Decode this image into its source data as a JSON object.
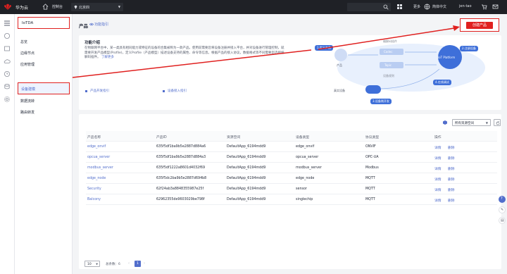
{
  "topbar": {
    "brand": "华为云",
    "console": "控制台",
    "region": "北京四",
    "more": "更多",
    "language": "简体中文",
    "user": "jen-tao"
  },
  "sidenav": {
    "header": "IoTDA",
    "items": [
      "总览",
      "边缘节点",
      "应用管理",
      "设备建模",
      "数据流转",
      "路由转发"
    ],
    "active_index": 3
  },
  "header": {
    "title": "产品",
    "guide": "功能指引",
    "create": "创建产品"
  },
  "intro": {
    "title": "功能介绍",
    "desc": "在物联网平台中，某一类具有相同能力或特征的设备的合集被称为一款产品。使用前需要您将设备注册并接入平台，并对设备进行管理控制，就需要开发产品模型(Profile)，定义Profile（产品模型）描述设备支持的属性、命令等信息。根据产品的接入协议，数据格式等不同需要您选择编解码插件。",
    "more": "了解更多",
    "links": [
      "产品开发指引",
      "设备接入指引"
    ],
    "diagram": {
      "product": "产品",
      "plugin": "编解码插件",
      "codec": "Codec",
      "topic": "Topic",
      "rules": "设备规则",
      "platform": "IoT Platform",
      "device": "真实设备",
      "steps": [
        "1.定义产品",
        "2.注册设备",
        "3.设备侧开发",
        "4.在线调试"
      ]
    }
  },
  "table": {
    "resource_filter": "所有资源空间",
    "columns": [
      "产品名称",
      "产品ID",
      "资源空间",
      "设备类型",
      "协议类型",
      "操作"
    ],
    "rows": [
      [
        "edge_onvif",
        "635f5df1ba9b5e2887d884a6",
        "DefaultApp_6194mdd9",
        "edge_onvif",
        "ONVIF"
      ],
      [
        "opcua_server",
        "635f5df1ba9b5e2887d884a3",
        "DefaultApp_6194mdd9",
        "opcua_server",
        "OPC-UA"
      ],
      [
        "modbus_server",
        "635f5df1222a8601d4032f69",
        "DefaultApp_6194mdd9",
        "modbus_server",
        "Modbus"
      ],
      [
        "edge_node",
        "635f5dc2ba9b5e2887d694b8",
        "DefaultApp_6194mdd9",
        "edge_node",
        "MQTT"
      ],
      [
        "Security",
        "62f24ab3a8848355987e25f",
        "DefaultApp_6194mdd9",
        "sensor",
        "MQTT"
      ],
      [
        "Balcony",
        "62962355de9603029be798f",
        "DefaultApp_6194mdd9",
        "singlechip",
        "MQTT"
      ]
    ],
    "ops": [
      "详情",
      "删除"
    ],
    "page_size": "10",
    "total_label": "总条数：6",
    "page": "1"
  }
}
